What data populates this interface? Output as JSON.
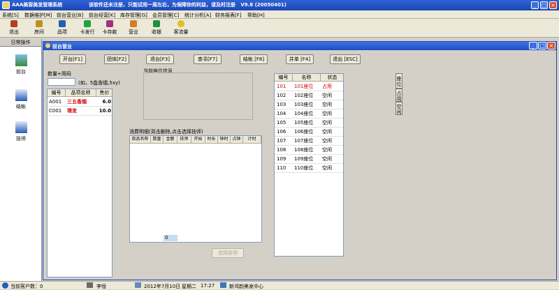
{
  "window": {
    "title": "AAA美容美发管理系统",
    "notice": "该软件还未注册，只能试用一周左右，为保障你的利益，请及时注册",
    "version": "V9.8 (20050401)",
    "minimize": "_",
    "maximize": "□",
    "close": "×"
  },
  "menu": [
    "系统[S]",
    "数据维护[M]",
    "前台营业[B]",
    "前台经营[K]",
    "库存管理[G]",
    "会员管理[C]",
    "统计分析[A]",
    "财务报表[F]",
    "帮助[H]"
  ],
  "toolbar": [
    {
      "label": "退出",
      "icon": "exit-icon",
      "color": "#b04020"
    },
    {
      "label": "房间",
      "icon": "room-icon",
      "color": "#c09020"
    },
    {
      "label": "品项",
      "icon": "items-icon",
      "color": "#2060b0"
    },
    {
      "label": "卡发行",
      "icon": "card-issue-icon",
      "color": "#20a040"
    },
    {
      "label": "卡存款",
      "icon": "card-deposit-icon",
      "color": "#a03080"
    },
    {
      "label": "营业",
      "icon": "business-icon",
      "color": "#d08020"
    },
    {
      "label": "收银",
      "icon": "cashier-icon",
      "color": "#209040"
    },
    {
      "label": "客流量",
      "icon": "traffic-icon",
      "color": "#e0c020"
    }
  ],
  "left_panel": {
    "header": "日常操作",
    "items": [
      {
        "label": "前台",
        "icon": "front-desk-icon",
        "color": "#3a8a3a"
      },
      {
        "label": "结帐",
        "icon": "checkout-icon",
        "color": "#2a5ab8"
      },
      {
        "label": "技师",
        "icon": "technician-icon",
        "color": "#2a5ab8"
      }
    ]
  },
  "subwindow": {
    "title": "前台营业",
    "buttons": {
      "open": "开台[F1]",
      "group": "团体[F2]",
      "return": "退台[F3]",
      "query": "查寻[F7]",
      "checkout": "结帐 [F8]",
      "merge": "并单 [F4]",
      "exit": "退出 [ESC]"
    },
    "qty_label": "数量+简码",
    "qty_hint": "(如，5盒香烟,5xy)",
    "current_seat_label": "当前座位信息",
    "consumption_label": "消费明细(双击删除,点击选择技师)",
    "select_tech_button": "选择技师",
    "items_table": {
      "headers": [
        "编号",
        "品项名称",
        "售价"
      ],
      "rows": [
        [
          "A001",
          "三五香烟",
          "6.0"
        ],
        [
          "C001",
          "理发",
          "10.0"
        ]
      ]
    },
    "consumption_table": {
      "headers": [
        "商品名称",
        "数量",
        "金额",
        "技师",
        "开始",
        "时长",
        "钟时",
        "点钟",
        "计时"
      ],
      "total_qty": "0"
    },
    "seats_table": {
      "headers": [
        "编号",
        "名称",
        "状态"
      ],
      "rows": [
        [
          "101",
          "101座位",
          "占用"
        ],
        [
          "102",
          "102座位",
          "空闲"
        ],
        [
          "103",
          "103座位",
          "空闲"
        ],
        [
          "104",
          "104座位",
          "空闲"
        ],
        [
          "105",
          "105座位",
          "空闲"
        ],
        [
          "106",
          "106座位",
          "空闲"
        ],
        [
          "107",
          "107座位",
          "空闲"
        ],
        [
          "108",
          "108座位",
          "空闲"
        ],
        [
          "109",
          "109座位",
          "空闲"
        ],
        [
          "110",
          "110座位",
          "空闲"
        ]
      ]
    },
    "side_tabs": [
      "座位",
      "占用",
      "空闲"
    ]
  },
  "status_bar": {
    "customers": "当前客户数：0",
    "user": "李恒",
    "date": "2012年7月10日",
    "weekday": "星期二",
    "time": "17:27",
    "company": "新鸿韵美发中心"
  }
}
